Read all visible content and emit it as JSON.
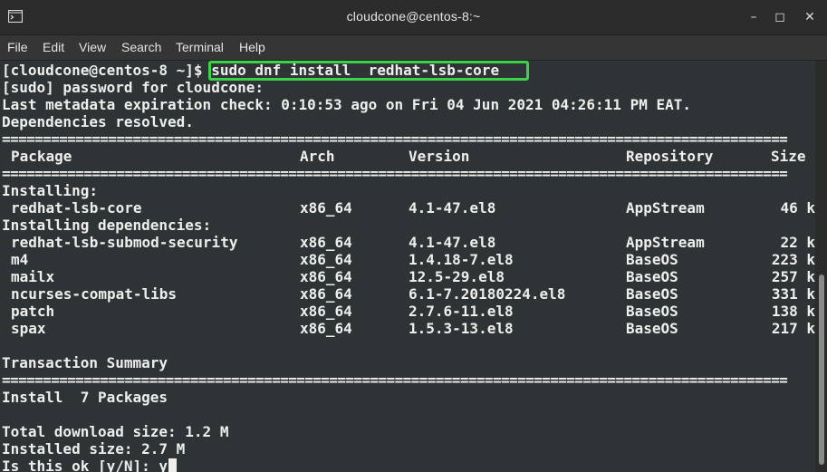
{
  "window": {
    "title": "cloudcone@centos-8:~",
    "controls": {
      "minimize": "–",
      "maximize": "◻",
      "close": "✕"
    }
  },
  "menu": {
    "file": "File",
    "edit": "Edit",
    "view": "View",
    "search": "Search",
    "terminal": "Terminal",
    "help": "Help"
  },
  "terminal": {
    "prompt": "[cloudcone@centos-8 ~]$ ",
    "command": "sudo dnf install  redhat-lsb-core",
    "sudo_prompt": "[sudo] password for cloudcone:",
    "metadata": "Last metadata expiration check: 0:10:53 ago on Fri 04 Jun 2021 04:26:11 PM EAT.",
    "deps_resolved": "Dependencies resolved.",
    "separator": "================================================================================================",
    "headers": {
      "package": "Package",
      "arch": "Arch",
      "version": "Version",
      "repository": "Repository",
      "size": "Size"
    },
    "installing_label": "Installing:",
    "installing": [
      {
        "package": "redhat-lsb-core",
        "arch": "x86_64",
        "version": "4.1-47.el8",
        "repository": "AppStream",
        "size": "46 k"
      }
    ],
    "deps_label": "Installing dependencies:",
    "dependencies": [
      {
        "package": "redhat-lsb-submod-security",
        "arch": "x86_64",
        "version": "4.1-47.el8",
        "repository": "AppStream",
        "size": "22 k"
      },
      {
        "package": "m4",
        "arch": "x86_64",
        "version": "1.4.18-7.el8",
        "repository": "BaseOS",
        "size": "223 k"
      },
      {
        "package": "mailx",
        "arch": "x86_64",
        "version": "12.5-29.el8",
        "repository": "BaseOS",
        "size": "257 k"
      },
      {
        "package": "ncurses-compat-libs",
        "arch": "x86_64",
        "version": "6.1-7.20180224.el8",
        "repository": "BaseOS",
        "size": "331 k"
      },
      {
        "package": "patch",
        "arch": "x86_64",
        "version": "2.7.6-11.el8",
        "repository": "BaseOS",
        "size": "138 k"
      },
      {
        "package": "spax",
        "arch": "x86_64",
        "version": "1.5.3-13.el8",
        "repository": "BaseOS",
        "size": "217 k"
      }
    ],
    "transaction_summary": "Transaction Summary",
    "install_count": "Install  7 Packages",
    "total_download": "Total download size: 1.2 M",
    "installed_size": "Installed size: 2.7 M",
    "confirm_prompt": "Is this ok [y/N]: y"
  },
  "colors": {
    "terminal_bg": "#2e3436",
    "terminal_fg": "#eeeeec",
    "highlight": "#3bd24a",
    "titlebar_bg": "#2c2c2c"
  }
}
